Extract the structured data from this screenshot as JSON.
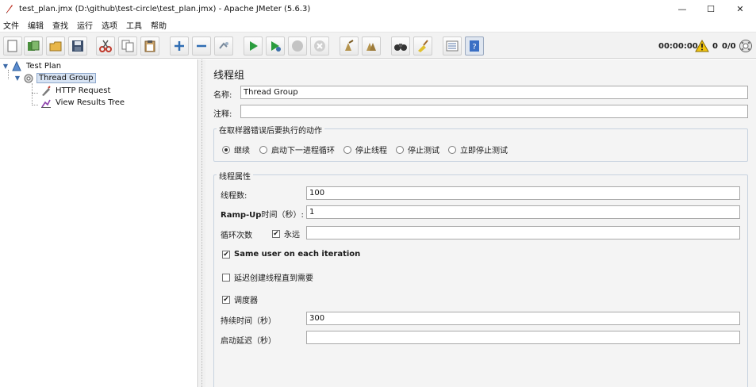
{
  "window": {
    "title": "test_plan.jmx (D:\\github\\test-circle\\test_plan.jmx) - Apache JMeter (5.6.3)",
    "controls": {
      "minimize": "—",
      "maximize": "☐",
      "close": "✕"
    }
  },
  "menu": {
    "items": [
      "文件",
      "编辑",
      "查找",
      "运行",
      "选项",
      "工具",
      "帮助"
    ]
  },
  "toolbar": {
    "buttons": [
      "new-icon",
      "templates-icon",
      "open-icon",
      "save-icon",
      "cut-icon",
      "copy-icon",
      "paste-icon",
      "expand-icon",
      "collapse-icon",
      "toggle-icon",
      "start-icon",
      "start-no-pause-icon",
      "stop-icon",
      "shutdown-icon",
      "clear-icon",
      "clear-all-icon",
      "search-icon",
      "reset-search-icon",
      "function-helper-icon",
      "help-icon"
    ],
    "status": {
      "elapsed": "00:00:00",
      "warnings": "0",
      "threads": "0/0"
    }
  },
  "tree": {
    "items": [
      {
        "label": "Test Plan",
        "level": 0,
        "icon": "test-plan-icon"
      },
      {
        "label": "Thread Group",
        "level": 1,
        "icon": "thread-group-icon",
        "selected": true
      },
      {
        "label": "HTTP Request",
        "level": 2,
        "icon": "sampler-icon"
      },
      {
        "label": "View Results Tree",
        "level": 2,
        "icon": "listener-icon"
      }
    ]
  },
  "panel": {
    "title": "线程组",
    "name_label": "名称:",
    "name_value": "Thread Group",
    "comment_label": "注释:",
    "comment_value": "",
    "error_group": {
      "title": "在取样器错误后要执行的动作",
      "options": [
        "继续",
        "启动下一进程循环",
        "停止线程",
        "停止测试",
        "立即停止测试"
      ],
      "selected": "继续"
    },
    "props_group": {
      "title": "线程属性",
      "threads_label": "线程数:",
      "threads_value": "100",
      "rampup_label_bold": "Ramp-Up",
      "rampup_label_rest": "时间（秒）:",
      "rampup_value": "1",
      "loop_label": "循环次数",
      "forever_label": "永远",
      "forever_checked": true,
      "loop_value": "",
      "same_user_label": "Same user on each iteration",
      "same_user_checked": true,
      "delay_label": "延迟创建线程直到需要",
      "delay_checked": false,
      "scheduler_label": "调度器",
      "scheduler_checked": true,
      "duration_label": "持续时间（秒）",
      "duration_value": "300",
      "startup_delay_label": "启动延迟（秒）",
      "startup_delay_value": ""
    }
  }
}
